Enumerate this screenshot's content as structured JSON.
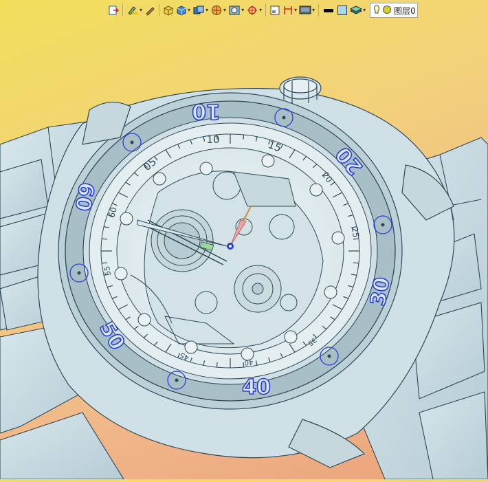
{
  "toolbar": {
    "buttons": [
      {
        "name": "exit-icon",
        "dropdown": false
      },
      {
        "name": "paint-brush-icon",
        "dropdown": true
      },
      {
        "name": "pencil-icon",
        "dropdown": false
      },
      {
        "name": "box-solid-icon",
        "dropdown": false
      },
      {
        "name": "cube-blue-icon",
        "dropdown": true
      },
      {
        "name": "view-cube-icon",
        "dropdown": true
      },
      {
        "name": "sphere-section-icon",
        "dropdown": true
      },
      {
        "name": "frame-icon",
        "dropdown": true
      },
      {
        "name": "target-icon",
        "dropdown": true
      },
      {
        "name": "small-frame-icon",
        "dropdown": false
      },
      {
        "name": "dimension-icon",
        "dropdown": true
      },
      {
        "name": "monitor-icon",
        "dropdown": true
      },
      {
        "name": "line-color-icon",
        "dropdown": false
      },
      {
        "name": "fill-color-icon",
        "dropdown": false
      },
      {
        "name": "layers-icon",
        "dropdown": true
      }
    ],
    "layer_label": "图层0"
  },
  "bezel_numbers": [
    "10",
    "20",
    "30",
    "40",
    "50",
    "60"
  ],
  "dial_numbers": [
    "10",
    "15",
    "20",
    "25",
    "35",
    "40",
    "45",
    "55",
    "60",
    "05"
  ],
  "colors": {
    "accent_blue": "#2a3fd6",
    "model_line": "#2e4856",
    "model_fill": "#c9dde4",
    "background_top": "#f2df5c",
    "background_bottom": "#eaa27a"
  }
}
